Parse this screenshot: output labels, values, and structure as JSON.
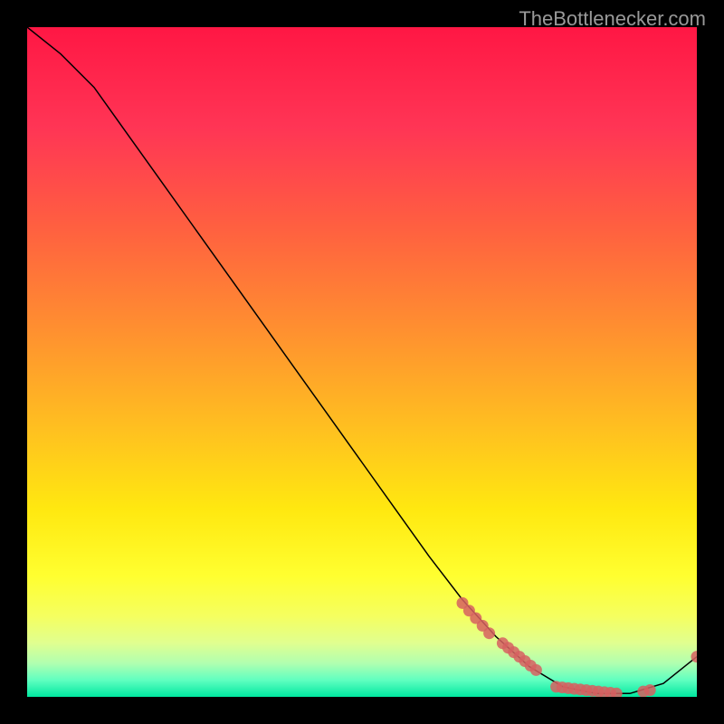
{
  "watermark": "TheBottlenecker.com",
  "chart_data": {
    "type": "line",
    "title": "",
    "xlabel": "",
    "ylabel": "",
    "xlim": [
      0,
      100
    ],
    "ylim": [
      0,
      100
    ],
    "curve": [
      {
        "x": 0,
        "y": 100
      },
      {
        "x": 5,
        "y": 96
      },
      {
        "x": 10,
        "y": 91
      },
      {
        "x": 15,
        "y": 84
      },
      {
        "x": 20,
        "y": 77
      },
      {
        "x": 25,
        "y": 70
      },
      {
        "x": 30,
        "y": 63
      },
      {
        "x": 35,
        "y": 56
      },
      {
        "x": 40,
        "y": 49
      },
      {
        "x": 45,
        "y": 42
      },
      {
        "x": 50,
        "y": 35
      },
      {
        "x": 55,
        "y": 28
      },
      {
        "x": 60,
        "y": 21
      },
      {
        "x": 65,
        "y": 14.5
      },
      {
        "x": 70,
        "y": 9
      },
      {
        "x": 75,
        "y": 4.5
      },
      {
        "x": 80,
        "y": 1.5
      },
      {
        "x": 85,
        "y": 0.5
      },
      {
        "x": 90,
        "y": 0.5
      },
      {
        "x": 95,
        "y": 2
      },
      {
        "x": 100,
        "y": 6
      }
    ],
    "marker_clusters": [
      {
        "x_start": 65,
        "x_end": 69,
        "y_start": 14,
        "y_end": 9.5
      },
      {
        "x_start": 71,
        "x_end": 76,
        "y_start": 8,
        "y_end": 4
      },
      {
        "x_start": 79,
        "x_end": 88,
        "y_start": 1.5,
        "y_end": 0.5
      },
      {
        "x_start": 92,
        "x_end": 93,
        "y_start": 0.8,
        "y_end": 1
      },
      {
        "x_start": 100,
        "x_end": 100,
        "y_start": 6,
        "y_end": 6
      }
    ],
    "gradient_stops": [
      {
        "offset": 0,
        "color": "#ff1744"
      },
      {
        "offset": 15,
        "color": "#ff3555"
      },
      {
        "offset": 30,
        "color": "#ff6040"
      },
      {
        "offset": 45,
        "color": "#ff8f30"
      },
      {
        "offset": 60,
        "color": "#ffc020"
      },
      {
        "offset": 72,
        "color": "#ffe810"
      },
      {
        "offset": 82,
        "color": "#ffff30"
      },
      {
        "offset": 88,
        "color": "#f5ff60"
      },
      {
        "offset": 92,
        "color": "#e0ff90"
      },
      {
        "offset": 95,
        "color": "#b0ffb0"
      },
      {
        "offset": 97.5,
        "color": "#60ffc0"
      },
      {
        "offset": 100,
        "color": "#00e8a0"
      }
    ]
  }
}
